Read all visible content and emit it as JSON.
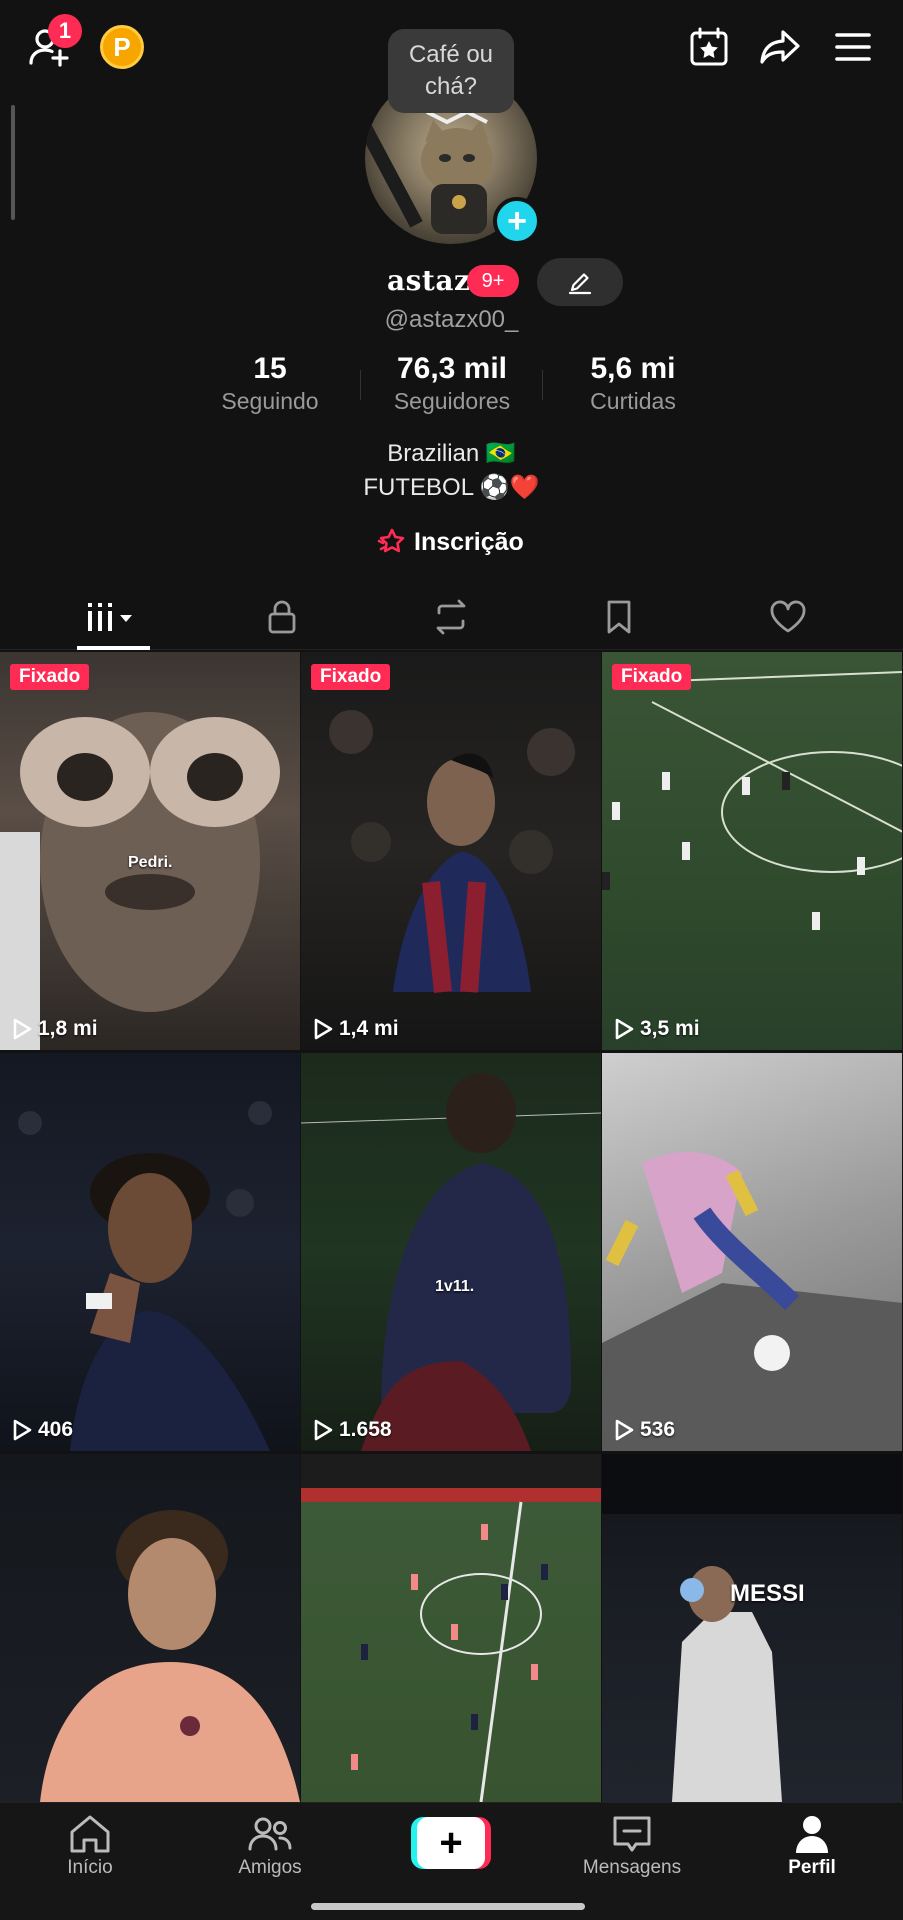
{
  "top_bar": {
    "notification_count": "1",
    "coin_label": "P"
  },
  "profile": {
    "status_bubble": "Café ou chá?",
    "avatar_add": "+",
    "display_name": "astazx",
    "name_badge": "9+",
    "handle": "@astazx00_",
    "stats": {
      "following_count": "15",
      "following_label": "Seguindo",
      "followers_count": "76,3 mil",
      "followers_label": "Seguidores",
      "likes_count": "5,6 mi",
      "likes_label": "Curtidas"
    },
    "bio_line1": "Brazilian 🇧🇷",
    "bio_line2": "FUTEBOL ⚽❤️",
    "subscribe_label": "Inscrição"
  },
  "tabs": [
    "videos",
    "private",
    "reposts",
    "saved",
    "liked"
  ],
  "videos": [
    {
      "pinned": "Fixado",
      "views": "1,8 mi",
      "overlay": "Pedri."
    },
    {
      "pinned": "Fixado",
      "views": "1,4 mi",
      "overlay": ""
    },
    {
      "pinned": "Fixado",
      "views": "3,5 mi",
      "overlay": ""
    },
    {
      "pinned": "",
      "views": "406",
      "overlay": ""
    },
    {
      "pinned": "",
      "views": "1.658",
      "overlay": "1v11."
    },
    {
      "pinned": "",
      "views": "536",
      "overlay": ""
    },
    {
      "pinned": "",
      "views": "",
      "overlay": ""
    },
    {
      "pinned": "",
      "views": "",
      "overlay": ""
    },
    {
      "pinned": "",
      "views": "",
      "overlay": "MESSI"
    }
  ],
  "bottom_nav": {
    "home": "Início",
    "friends": "Amigos",
    "create": "+",
    "messages": "Mensagens",
    "profile": "Perfil"
  },
  "colors": {
    "accent": "#fe2c55",
    "cyan": "#25f4ee",
    "background": "#121212"
  }
}
